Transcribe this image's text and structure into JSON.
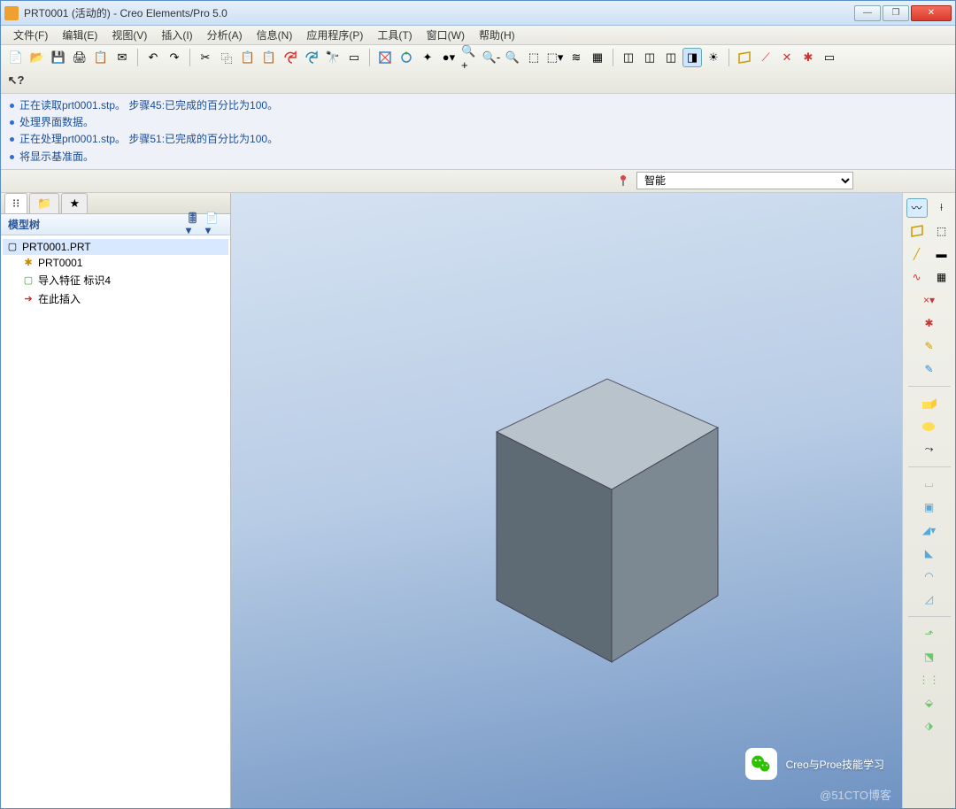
{
  "window": {
    "title": "PRT0001 (活动的) - Creo Elements/Pro 5.0"
  },
  "menu": [
    "文件(F)",
    "编辑(E)",
    "视图(V)",
    "插入(I)",
    "分析(A)",
    "信息(N)",
    "应用程序(P)",
    "工具(T)",
    "窗口(W)",
    "帮助(H)"
  ],
  "messages": [
    "正在读取prt0001.stp。 步骤45:已完成的百分比为100。",
    "处理界面数据。",
    "正在处理prt0001.stp。 步骤51:已完成的百分比为100。",
    "将显示基准面。"
  ],
  "filter": {
    "selected": "智能"
  },
  "panel": {
    "header": "模型树"
  },
  "tree": {
    "root": "PRT0001.PRT",
    "nodes": [
      "PRT0001",
      "导入特征 标识4",
      "在此插入"
    ]
  },
  "watermark": {
    "main": "Creo与Proe技能学习",
    "sub": "@51CTO博客"
  }
}
